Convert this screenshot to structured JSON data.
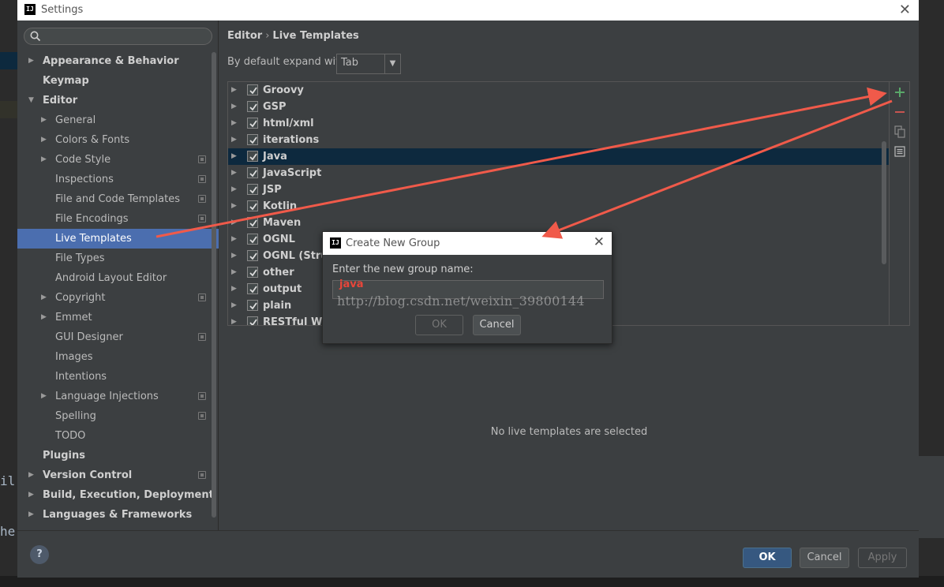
{
  "background": {
    "left_code_1": "il",
    "left_code_2": "he"
  },
  "window": {
    "title": "Settings",
    "app_badge": "IJ"
  },
  "sidebar": {
    "search_placeholder": "",
    "items": [
      {
        "label": "Appearance & Behavior",
        "level": 0,
        "arrow": "right",
        "bold": true,
        "project": false,
        "selected": false
      },
      {
        "label": "Keymap",
        "level": 0,
        "arrow": "",
        "bold": true,
        "project": false,
        "selected": false
      },
      {
        "label": "Editor",
        "level": 0,
        "arrow": "down",
        "bold": true,
        "project": false,
        "selected": false
      },
      {
        "label": "General",
        "level": 1,
        "arrow": "right",
        "bold": false,
        "project": false,
        "selected": false
      },
      {
        "label": "Colors & Fonts",
        "level": 1,
        "arrow": "right",
        "bold": false,
        "project": false,
        "selected": false
      },
      {
        "label": "Code Style",
        "level": 1,
        "arrow": "right",
        "bold": false,
        "project": true,
        "selected": false
      },
      {
        "label": "Inspections",
        "level": 1,
        "arrow": "",
        "bold": false,
        "project": true,
        "selected": false
      },
      {
        "label": "File and Code Templates",
        "level": 1,
        "arrow": "",
        "bold": false,
        "project": true,
        "selected": false
      },
      {
        "label": "File Encodings",
        "level": 1,
        "arrow": "",
        "bold": false,
        "project": true,
        "selected": false
      },
      {
        "label": "Live Templates",
        "level": 1,
        "arrow": "",
        "bold": false,
        "project": false,
        "selected": true
      },
      {
        "label": "File Types",
        "level": 1,
        "arrow": "",
        "bold": false,
        "project": false,
        "selected": false
      },
      {
        "label": "Android Layout Editor",
        "level": 1,
        "arrow": "",
        "bold": false,
        "project": false,
        "selected": false
      },
      {
        "label": "Copyright",
        "level": 1,
        "arrow": "right",
        "bold": false,
        "project": true,
        "selected": false
      },
      {
        "label": "Emmet",
        "level": 1,
        "arrow": "right",
        "bold": false,
        "project": false,
        "selected": false
      },
      {
        "label": "GUI Designer",
        "level": 1,
        "arrow": "",
        "bold": false,
        "project": true,
        "selected": false
      },
      {
        "label": "Images",
        "level": 1,
        "arrow": "",
        "bold": false,
        "project": false,
        "selected": false
      },
      {
        "label": "Intentions",
        "level": 1,
        "arrow": "",
        "bold": false,
        "project": false,
        "selected": false
      },
      {
        "label": "Language Injections",
        "level": 1,
        "arrow": "right",
        "bold": false,
        "project": true,
        "selected": false
      },
      {
        "label": "Spelling",
        "level": 1,
        "arrow": "",
        "bold": false,
        "project": true,
        "selected": false
      },
      {
        "label": "TODO",
        "level": 1,
        "arrow": "",
        "bold": false,
        "project": false,
        "selected": false
      },
      {
        "label": "Plugins",
        "level": 0,
        "arrow": "",
        "bold": true,
        "project": false,
        "selected": false
      },
      {
        "label": "Version Control",
        "level": 0,
        "arrow": "right",
        "bold": true,
        "project": true,
        "selected": false
      },
      {
        "label": "Build, Execution, Deployment",
        "level": 0,
        "arrow": "right",
        "bold": true,
        "project": false,
        "selected": false
      },
      {
        "label": "Languages & Frameworks",
        "level": 0,
        "arrow": "right",
        "bold": true,
        "project": false,
        "selected": false
      }
    ]
  },
  "main": {
    "breadcrumb": [
      "Editor",
      "Live Templates"
    ],
    "breadcrumb_sep": "›",
    "expand_label": "By default expand with",
    "expand_value": "Tab",
    "templates": [
      {
        "name": "Groovy",
        "checked": true,
        "selected": false
      },
      {
        "name": "GSP",
        "checked": true,
        "selected": false
      },
      {
        "name": "html/xml",
        "checked": true,
        "selected": false
      },
      {
        "name": "iterations",
        "checked": true,
        "selected": false
      },
      {
        "name": "Java",
        "checked": true,
        "selected": true
      },
      {
        "name": "JavaScript",
        "checked": true,
        "selected": false
      },
      {
        "name": "JSP",
        "checked": true,
        "selected": false
      },
      {
        "name": "Kotlin",
        "checked": true,
        "selected": false
      },
      {
        "name": "Maven",
        "checked": true,
        "selected": false
      },
      {
        "name": "OGNL",
        "checked": true,
        "selected": false
      },
      {
        "name": "OGNL (Strut",
        "checked": true,
        "selected": false
      },
      {
        "name": "other",
        "checked": true,
        "selected": false
      },
      {
        "name": "output",
        "checked": true,
        "selected": false
      },
      {
        "name": "plain",
        "checked": true,
        "selected": false
      },
      {
        "name": "RESTful Web",
        "checked": true,
        "selected": false
      }
    ],
    "toolbar": {
      "add_icon": "plus-icon",
      "remove_icon": "minus-icon",
      "copy_icon": "copy-icon",
      "edit_icon": "edit-icon",
      "add_color": "#59a869",
      "remove_color": "#c75450"
    },
    "empty_message": "No live templates are selected"
  },
  "footer": {
    "help": "?",
    "ok": "OK",
    "cancel": "Cancel",
    "apply": "Apply"
  },
  "dialog": {
    "app_badge": "IJ",
    "title": "Create New Group",
    "prompt": "Enter the new group name:",
    "input_value": "java",
    "ok": "OK",
    "cancel": "Cancel",
    "watermark": "http://blog.csdn.net/weixin_39800144"
  },
  "annotation": {
    "arrow_color": "#f05a4a"
  }
}
